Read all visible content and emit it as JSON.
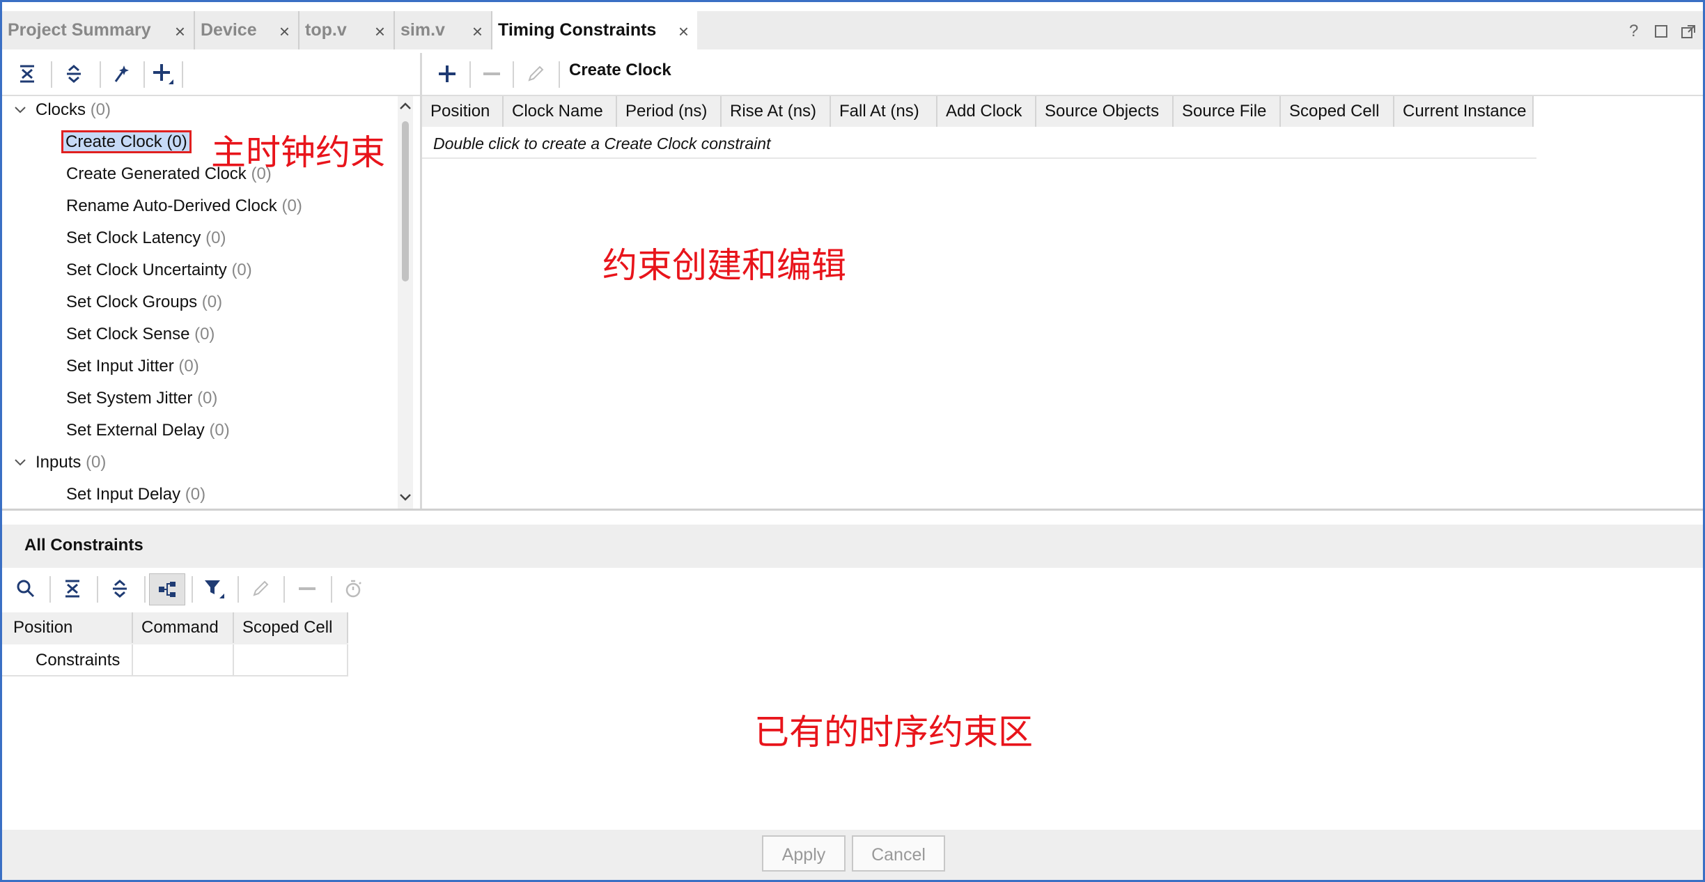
{
  "tabs": [
    {
      "label": "Project Summary",
      "close": "×"
    },
    {
      "label": "Device",
      "close": "×"
    },
    {
      "label": "top.v",
      "close": "×"
    },
    {
      "label": "sim.v",
      "close": "×"
    },
    {
      "label": "Timing Constraints",
      "close": "×"
    }
  ],
  "window_controls": {
    "help": "?"
  },
  "tree": {
    "groups": [
      {
        "label": "Clocks",
        "count": "(0)"
      },
      {
        "label": "Inputs",
        "count": "(0)"
      }
    ],
    "items": [
      {
        "label": "Create Clock",
        "count": "(0)"
      },
      {
        "label": "Create Generated Clock",
        "count": "(0)"
      },
      {
        "label": "Rename Auto-Derived Clock",
        "count": "(0)"
      },
      {
        "label": "Set Clock Latency",
        "count": "(0)"
      },
      {
        "label": "Set Clock Uncertainty",
        "count": "(0)"
      },
      {
        "label": "Set Clock Groups",
        "count": "(0)"
      },
      {
        "label": "Set Clock Sense",
        "count": "(0)"
      },
      {
        "label": "Set Input Jitter",
        "count": "(0)"
      },
      {
        "label": "Set System Jitter",
        "count": "(0)"
      },
      {
        "label": "Set External Delay",
        "count": "(0)"
      },
      {
        "label": "Set Input Delay",
        "count": "(0)"
      }
    ]
  },
  "editor": {
    "title": "Create Clock",
    "columns": [
      "Position",
      "Clock Name",
      "Period (ns)",
      "Rise At (ns)",
      "Fall At (ns)",
      "Add Clock",
      "Source Objects",
      "Source File",
      "Scoped Cell",
      "Current Instance"
    ],
    "hint": "Double click to create a Create Clock constraint"
  },
  "annotations": {
    "main_clock": "主时钟约束",
    "editor_area": "约束创建和编辑",
    "existing_area": "已有的时序约束区"
  },
  "all_constraints": {
    "title": "All Constraints",
    "columns": [
      "Position",
      "Command",
      "Scoped Cell"
    ],
    "row": {
      "position": "Constraints",
      "command": "",
      "scoped_cell": ""
    }
  },
  "footer": {
    "apply": "Apply",
    "cancel": "Cancel"
  },
  "colors": {
    "frame": "#3a6fc4",
    "accent_icon": "#1f3b73",
    "annotation": "#e8141b",
    "selection": "#c6daf7"
  }
}
